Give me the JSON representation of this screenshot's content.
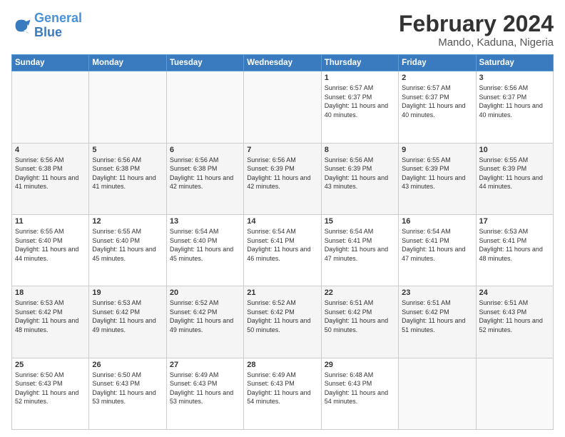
{
  "logo": {
    "line1": "General",
    "line2": "Blue"
  },
  "title": "February 2024",
  "subtitle": "Mando, Kaduna, Nigeria",
  "days_header": [
    "Sunday",
    "Monday",
    "Tuesday",
    "Wednesday",
    "Thursday",
    "Friday",
    "Saturday"
  ],
  "weeks": [
    [
      {
        "day": "",
        "sunrise": "",
        "sunset": "",
        "daylight": ""
      },
      {
        "day": "",
        "sunrise": "",
        "sunset": "",
        "daylight": ""
      },
      {
        "day": "",
        "sunrise": "",
        "sunset": "",
        "daylight": ""
      },
      {
        "day": "",
        "sunrise": "",
        "sunset": "",
        "daylight": ""
      },
      {
        "day": "1",
        "sunrise": "Sunrise: 6:57 AM",
        "sunset": "Sunset: 6:37 PM",
        "daylight": "Daylight: 11 hours and 40 minutes."
      },
      {
        "day": "2",
        "sunrise": "Sunrise: 6:57 AM",
        "sunset": "Sunset: 6:37 PM",
        "daylight": "Daylight: 11 hours and 40 minutes."
      },
      {
        "day": "3",
        "sunrise": "Sunrise: 6:56 AM",
        "sunset": "Sunset: 6:37 PM",
        "daylight": "Daylight: 11 hours and 40 minutes."
      }
    ],
    [
      {
        "day": "4",
        "sunrise": "Sunrise: 6:56 AM",
        "sunset": "Sunset: 6:38 PM",
        "daylight": "Daylight: 11 hours and 41 minutes."
      },
      {
        "day": "5",
        "sunrise": "Sunrise: 6:56 AM",
        "sunset": "Sunset: 6:38 PM",
        "daylight": "Daylight: 11 hours and 41 minutes."
      },
      {
        "day": "6",
        "sunrise": "Sunrise: 6:56 AM",
        "sunset": "Sunset: 6:38 PM",
        "daylight": "Daylight: 11 hours and 42 minutes."
      },
      {
        "day": "7",
        "sunrise": "Sunrise: 6:56 AM",
        "sunset": "Sunset: 6:39 PM",
        "daylight": "Daylight: 11 hours and 42 minutes."
      },
      {
        "day": "8",
        "sunrise": "Sunrise: 6:56 AM",
        "sunset": "Sunset: 6:39 PM",
        "daylight": "Daylight: 11 hours and 43 minutes."
      },
      {
        "day": "9",
        "sunrise": "Sunrise: 6:55 AM",
        "sunset": "Sunset: 6:39 PM",
        "daylight": "Daylight: 11 hours and 43 minutes."
      },
      {
        "day": "10",
        "sunrise": "Sunrise: 6:55 AM",
        "sunset": "Sunset: 6:39 PM",
        "daylight": "Daylight: 11 hours and 44 minutes."
      }
    ],
    [
      {
        "day": "11",
        "sunrise": "Sunrise: 6:55 AM",
        "sunset": "Sunset: 6:40 PM",
        "daylight": "Daylight: 11 hours and 44 minutes."
      },
      {
        "day": "12",
        "sunrise": "Sunrise: 6:55 AM",
        "sunset": "Sunset: 6:40 PM",
        "daylight": "Daylight: 11 hours and 45 minutes."
      },
      {
        "day": "13",
        "sunrise": "Sunrise: 6:54 AM",
        "sunset": "Sunset: 6:40 PM",
        "daylight": "Daylight: 11 hours and 45 minutes."
      },
      {
        "day": "14",
        "sunrise": "Sunrise: 6:54 AM",
        "sunset": "Sunset: 6:41 PM",
        "daylight": "Daylight: 11 hours and 46 minutes."
      },
      {
        "day": "15",
        "sunrise": "Sunrise: 6:54 AM",
        "sunset": "Sunset: 6:41 PM",
        "daylight": "Daylight: 11 hours and 47 minutes."
      },
      {
        "day": "16",
        "sunrise": "Sunrise: 6:54 AM",
        "sunset": "Sunset: 6:41 PM",
        "daylight": "Daylight: 11 hours and 47 minutes."
      },
      {
        "day": "17",
        "sunrise": "Sunrise: 6:53 AM",
        "sunset": "Sunset: 6:41 PM",
        "daylight": "Daylight: 11 hours and 48 minutes."
      }
    ],
    [
      {
        "day": "18",
        "sunrise": "Sunrise: 6:53 AM",
        "sunset": "Sunset: 6:42 PM",
        "daylight": "Daylight: 11 hours and 48 minutes."
      },
      {
        "day": "19",
        "sunrise": "Sunrise: 6:53 AM",
        "sunset": "Sunset: 6:42 PM",
        "daylight": "Daylight: 11 hours and 49 minutes."
      },
      {
        "day": "20",
        "sunrise": "Sunrise: 6:52 AM",
        "sunset": "Sunset: 6:42 PM",
        "daylight": "Daylight: 11 hours and 49 minutes."
      },
      {
        "day": "21",
        "sunrise": "Sunrise: 6:52 AM",
        "sunset": "Sunset: 6:42 PM",
        "daylight": "Daylight: 11 hours and 50 minutes."
      },
      {
        "day": "22",
        "sunrise": "Sunrise: 6:51 AM",
        "sunset": "Sunset: 6:42 PM",
        "daylight": "Daylight: 11 hours and 50 minutes."
      },
      {
        "day": "23",
        "sunrise": "Sunrise: 6:51 AM",
        "sunset": "Sunset: 6:42 PM",
        "daylight": "Daylight: 11 hours and 51 minutes."
      },
      {
        "day": "24",
        "sunrise": "Sunrise: 6:51 AM",
        "sunset": "Sunset: 6:43 PM",
        "daylight": "Daylight: 11 hours and 52 minutes."
      }
    ],
    [
      {
        "day": "25",
        "sunrise": "Sunrise: 6:50 AM",
        "sunset": "Sunset: 6:43 PM",
        "daylight": "Daylight: 11 hours and 52 minutes."
      },
      {
        "day": "26",
        "sunrise": "Sunrise: 6:50 AM",
        "sunset": "Sunset: 6:43 PM",
        "daylight": "Daylight: 11 hours and 53 minutes."
      },
      {
        "day": "27",
        "sunrise": "Sunrise: 6:49 AM",
        "sunset": "Sunset: 6:43 PM",
        "daylight": "Daylight: 11 hours and 53 minutes."
      },
      {
        "day": "28",
        "sunrise": "Sunrise: 6:49 AM",
        "sunset": "Sunset: 6:43 PM",
        "daylight": "Daylight: 11 hours and 54 minutes."
      },
      {
        "day": "29",
        "sunrise": "Sunrise: 6:48 AM",
        "sunset": "Sunset: 6:43 PM",
        "daylight": "Daylight: 11 hours and 54 minutes."
      },
      {
        "day": "",
        "sunrise": "",
        "sunset": "",
        "daylight": ""
      },
      {
        "day": "",
        "sunrise": "",
        "sunset": "",
        "daylight": ""
      }
    ]
  ]
}
